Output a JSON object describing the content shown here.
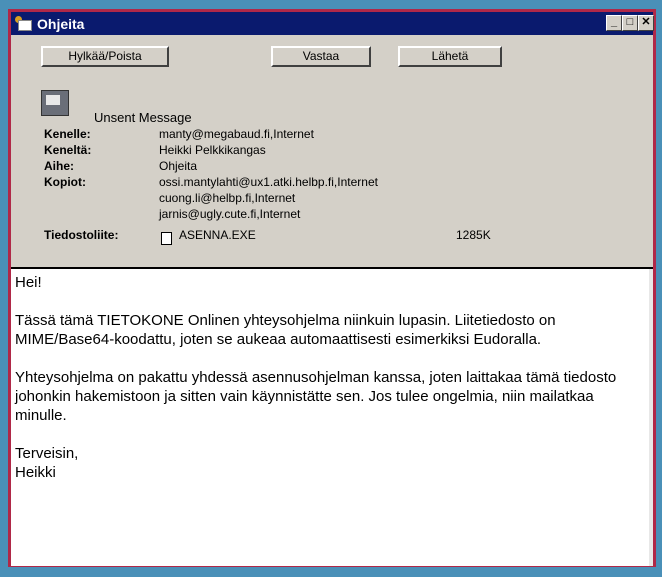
{
  "window": {
    "title": "Ohjeita"
  },
  "titlebar_controls": {
    "minimize": "_",
    "maximize": "□",
    "close": "✕"
  },
  "toolbar": {
    "reject_label": "Hylkää/Poista",
    "reply_label": "Vastaa",
    "send_label": "Lähetä"
  },
  "message": {
    "status": "Unsent Message",
    "to_label": "Kenelle:",
    "to_value": "manty@megabaud.fi,Internet",
    "from_label": "Keneltä:",
    "from_value": "Heikki Pelkkikangas",
    "subject_label": "Aihe:",
    "subject_value": "Ohjeita",
    "cc_label": "Kopiot:",
    "cc_values": [
      "ossi.mantylahti@ux1.atki.helbp.fi,Internet",
      "cuong.li@helbp.fi,Internet",
      "jarnis@ugly.cute.fi,Internet"
    ],
    "attachment_label": "Tiedostoliite:",
    "attachment_name": "ASENNA.EXE",
    "attachment_size": "1285K"
  },
  "body": {
    "greeting": "Hei!",
    "para1": "Tässä tämä TIETOKONE Onlinen yhteysohjelma niinkuin lupasin.  Liitetiedosto on MIME/Base64-koodattu, joten se aukeaa automaattisesti esimerkiksi Eudoralla.",
    "para2": "Yhteysohjelma on pakattu yhdessä asennusohjelman kanssa, joten laittakaa tämä tiedosto johonkin hakemistoon ja sitten vain käynnistätte sen.  Jos tulee ongelmia, niin mailatkaa minulle.",
    "closing": "Terveisin,",
    "signature": "Heikki"
  },
  "colors": {
    "titlebar": "#0a1a6e",
    "window_border": "#b02848",
    "desktop": "#4a90b8"
  }
}
